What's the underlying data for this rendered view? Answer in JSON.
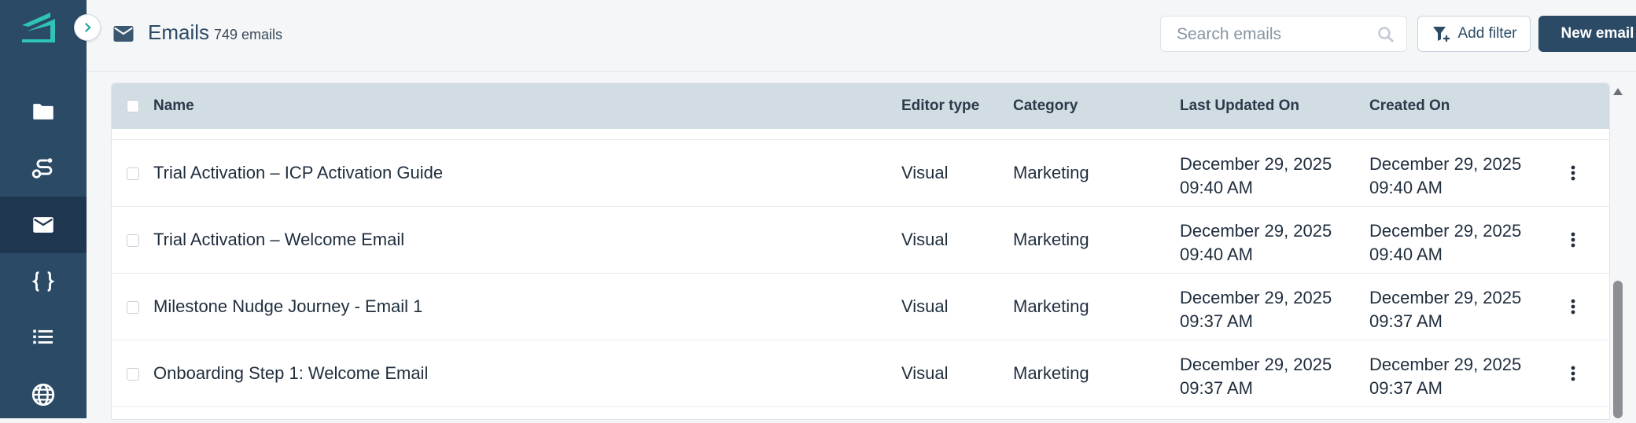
{
  "sidebar": {
    "items": [
      {
        "icon": "folder-icon",
        "name": "sidebar-item-folders"
      },
      {
        "icon": "journey-icon",
        "name": "sidebar-item-journeys"
      },
      {
        "icon": "mail-icon",
        "name": "sidebar-item-emails"
      },
      {
        "icon": "curly-braces-icon",
        "name": "sidebar-item-variables"
      },
      {
        "icon": "list-icon",
        "name": "sidebar-item-lists"
      },
      {
        "icon": "globe-icon",
        "name": "sidebar-item-domains"
      }
    ]
  },
  "header": {
    "title": "Emails",
    "count": "749 emails",
    "search_placeholder": "Search emails",
    "add_filter": "Add filter",
    "new_email": "New email"
  },
  "table": {
    "columns": [
      "Name",
      "Editor type",
      "Category",
      "Last Updated On",
      "Created On"
    ],
    "rows": [
      {
        "name": "Trial Activation – ICP Activation Guide",
        "editor": "Visual",
        "category": "Marketing",
        "updated_date": "December 29, 2025",
        "updated_time": "09:40 AM",
        "created_date": "December 29, 2025",
        "created_time": "09:40 AM"
      },
      {
        "name": "Trial Activation – Welcome Email",
        "editor": "Visual",
        "category": "Marketing",
        "updated_date": "December 29, 2025",
        "updated_time": "09:40 AM",
        "created_date": "December 29, 2025",
        "created_time": "09:40 AM"
      },
      {
        "name": "Milestone Nudge Journey - Email 1",
        "editor": "Visual",
        "category": "Marketing",
        "updated_date": "December 29, 2025",
        "updated_time": "09:37 AM",
        "created_date": "December 29, 2025",
        "created_time": "09:37 AM"
      },
      {
        "name": "Onboarding Step 1: Welcome Email",
        "editor": "Visual",
        "category": "Marketing",
        "updated_date": "December 29, 2025",
        "updated_time": "09:37 AM",
        "created_date": "December 29, 2025",
        "created_time": "09:37 AM"
      }
    ]
  },
  "colors": {
    "sidebar": "#2b4a66",
    "sidebar_active": "#1e3650",
    "logo": "#2ec4b6",
    "primary_button": "#2b4a66",
    "table_header": "#d2dde3"
  }
}
